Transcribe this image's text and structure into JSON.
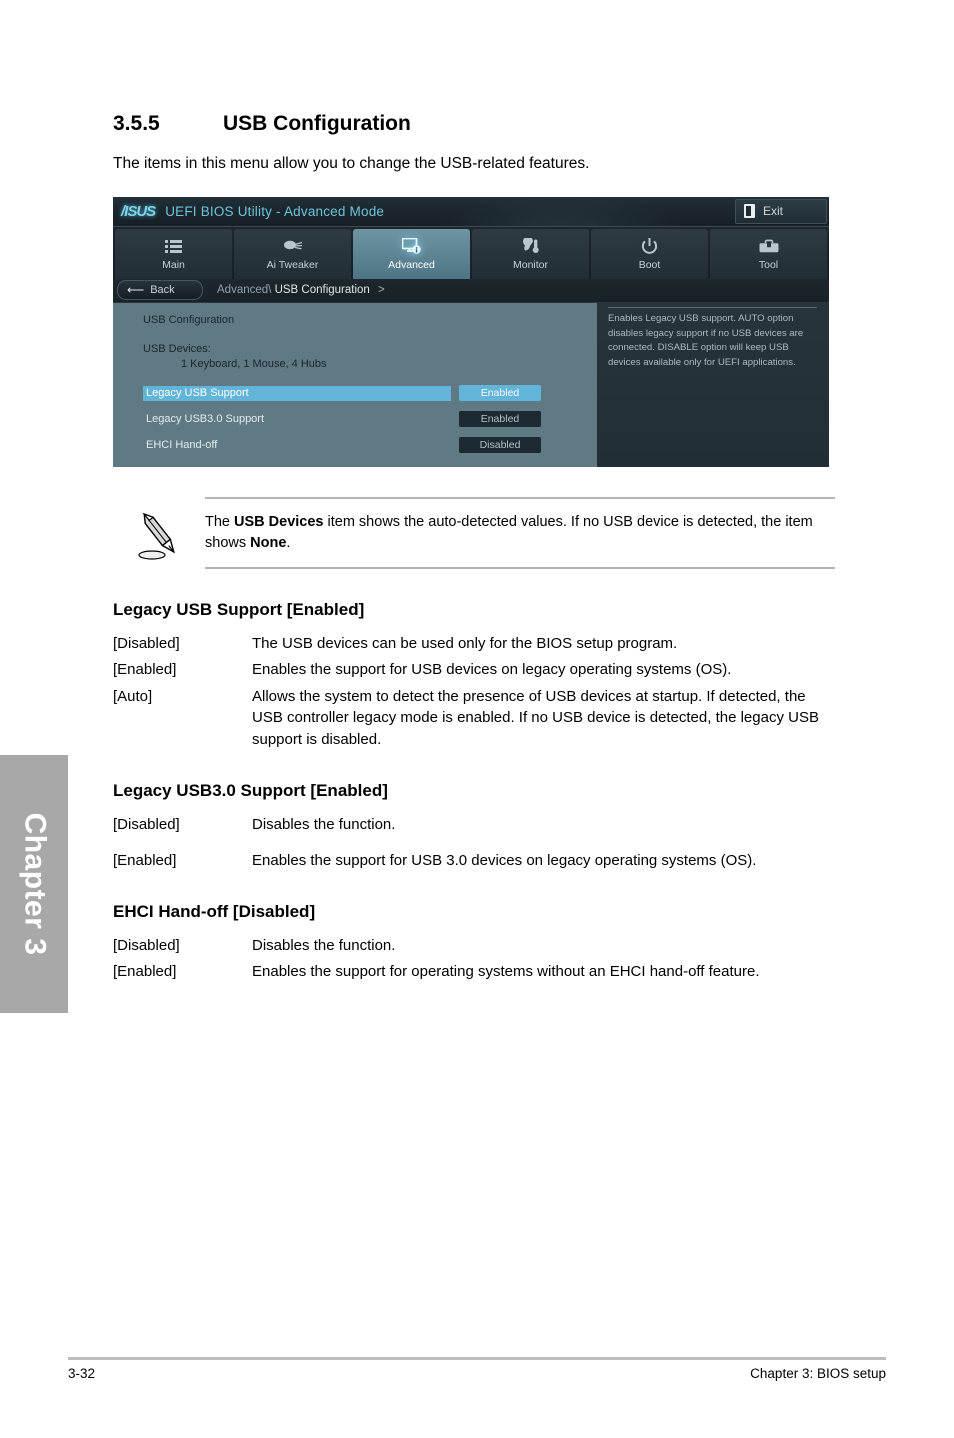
{
  "page": {
    "section_number": "3.5.5",
    "section_title": "USB Configuration",
    "intro": "The items in this menu allow you to change the USB-related features.",
    "chapter_tab": "Chapter 3",
    "footer_left": "3-32",
    "footer_right": "Chapter 3: BIOS setup"
  },
  "bios": {
    "brand": "/ISUS",
    "title": "UEFI BIOS Utility - Advanced Mode",
    "exit_label": "Exit",
    "tabs": [
      {
        "label": "Main",
        "icon": "list-icon",
        "active": false
      },
      {
        "label": "Ai  Tweaker",
        "icon": "tweaker-icon",
        "active": false
      },
      {
        "label": "Advanced",
        "icon": "monitor-info-icon",
        "active": true
      },
      {
        "label": "Monitor",
        "icon": "fan-temp-icon",
        "active": false
      },
      {
        "label": "Boot",
        "icon": "power-icon",
        "active": false
      },
      {
        "label": "Tool",
        "icon": "toolbox-icon",
        "active": false
      }
    ],
    "back_label": "Back",
    "breadcrumb_parent": "Advanced\\",
    "breadcrumb_current": "USB Configuration",
    "breadcrumb_arrow": ">",
    "panel": {
      "heading": "USB Configuration",
      "devices_label": "USB Devices:",
      "devices_value": "1 Keyboard, 1 Mouse, 4 Hubs",
      "items": [
        {
          "name": "Legacy USB Support",
          "value": "Enabled",
          "selected": true
        },
        {
          "name": "Legacy USB3.0 Support",
          "value": "Enabled",
          "selected": false
        },
        {
          "name": "EHCI Hand-off",
          "value": "Disabled",
          "selected": false
        }
      ]
    },
    "help_text": "Enables Legacy USB support. AUTO option disables legacy support if no USB devices are connected. DISABLE option will keep USB devices available only for UEFI applications.",
    "colors": {
      "panel_bg": "#5f7a85",
      "selection": "#62b4d8",
      "title_text": "#6fc4dc",
      "dark_bg": "#1b2429"
    }
  },
  "note": {
    "text_1": "The ",
    "bold_1": "USB Devices",
    "text_2": " item shows the auto-detected values. If no USB device is detected, the item shows ",
    "bold_2": "None",
    "text_3": "."
  },
  "sections": [
    {
      "heading": "Legacy USB Support [Enabled]",
      "rows": [
        {
          "key": "[Disabled]",
          "val": "The USB devices can be used only for the BIOS setup program."
        },
        {
          "key": "[Enabled]",
          "val": "Enables the support for USB devices on legacy operating systems (OS)."
        },
        {
          "key": "[Auto]",
          "val": "Allows the system to detect the presence of USB devices at startup. If detected, the USB controller legacy mode is enabled. If no USB device is detected, the legacy USB support is disabled."
        }
      ]
    },
    {
      "heading": "Legacy USB3.0 Support [Enabled]",
      "rows": [
        {
          "key": "[Disabled]",
          "val": "Disables the function."
        },
        {
          "key": "[Enabled]",
          "val": "Enables the support for USB 3.0 devices on legacy operating systems (OS)."
        }
      ]
    },
    {
      "heading": "EHCI Hand-off [Disabled]",
      "rows": [
        {
          "key": "[Disabled]",
          "val": "Disables the function."
        },
        {
          "key": "[Enabled]",
          "val": "Enables the support for operating systems without an EHCI hand-off feature."
        }
      ]
    }
  ]
}
